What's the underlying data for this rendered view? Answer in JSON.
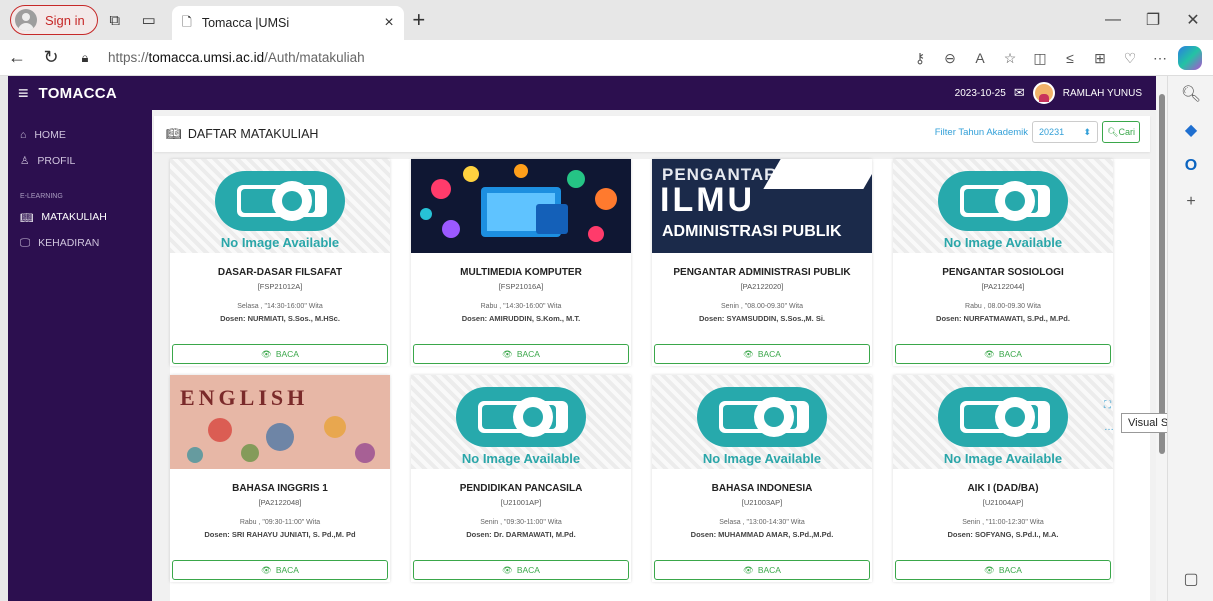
{
  "browser": {
    "signin_label": "Sign in",
    "tab_title": "Tomacca |UMSi",
    "url_prefix": "https://",
    "url_host": "tomacca.umsi.ac.id",
    "url_path": "/Auth/matakuliah"
  },
  "app": {
    "brand": "TOMACCA",
    "date": "2023-10-25",
    "user": "RAMLAH YUNUS"
  },
  "sidebar": {
    "home": "HOME",
    "profil": "PROFIL",
    "section": "E-LEARNING",
    "matakuliah": "MATAKULIAH",
    "kehadiran": "KEHADIRAN"
  },
  "page": {
    "title": "DAFTAR MATAKULIAH",
    "filter_label": "Filter Tahun Akademik",
    "filter_value": "20231",
    "search_button": "Cari"
  },
  "tooltip": "Visual Search",
  "no_image_text": "No Image Available",
  "baca_label": "BACA",
  "courses": [
    {
      "title": "DASAR-DASAR FILSAFAT",
      "code": "[FSP21012A]",
      "schedule": "Selasa , \"14:30-16:00\" Wita",
      "dosen": "Dosen: NURMIATI, S.Sos., M.HSc."
    },
    {
      "title": "MULTIMEDIA KOMPUTER",
      "code": "[FSP21016A]",
      "schedule": "Rabu , \"14:30-16:00\" Wita",
      "dosen": "Dosen: AMIRUDDIN, S.Kom., M.T."
    },
    {
      "title": "PENGANTAR ADMINISTRASI PUBLIK",
      "code": "[PA2122020]",
      "schedule": "Senin , \"08.00-09.30\" Wita",
      "dosen": "Dosen: SYAMSUDDIN, S.Sos.,M. Si."
    },
    {
      "title": "PENGANTAR SOSIOLOGI",
      "code": "[PA2122044]",
      "schedule": "Rabu , 08.00-09.30 Wita",
      "dosen": "Dosen: NURFATMAWATI, S.Pd., M.Pd."
    },
    {
      "title": "BAHASA INGGRIS 1",
      "code": "[PA2122048]",
      "schedule": "Rabu , \"09:30-11:00\" Wita",
      "dosen": "Dosen: SRI RAHAYU JUNIATI, S. Pd.,M. Pd"
    },
    {
      "title": "PENDIDIKAN PANCASILA",
      "code": "[U21001AP]",
      "schedule": "Senin , \"09:30-11:00\" Wita",
      "dosen": "Dosen: Dr. DARMAWATI, M.Pd."
    },
    {
      "title": "BAHASA INDONESIA",
      "code": "[U21003AP]",
      "schedule": "Selasa , \"13:00-14:30\" Wita",
      "dosen": "Dosen: MUHAMMAD AMAR, S.Pd.,M.Pd."
    },
    {
      "title": "AIK I (DAD/BA)",
      "code": "[U21004AP]",
      "schedule": "Senin , \"11:00-12:30\" Wita",
      "dosen": "Dosen: SOFYANG, S.Pd.I., M.A."
    }
  ],
  "thumb_texts": {
    "adm_line1": "PENGANTAR",
    "adm_line2": "ILMU",
    "adm_line3": "ADMINISTRASI PUBLIK",
    "eng": "ENGLISH"
  }
}
